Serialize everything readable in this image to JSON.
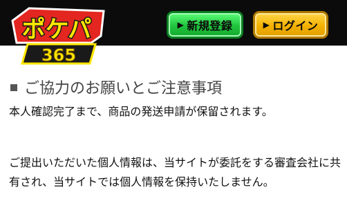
{
  "header": {
    "logo_text_main": "ポケパ",
    "logo_text_sub": "365",
    "register_button": "新規登録",
    "login_button": "ログイン"
  },
  "main": {
    "section_title": "ご協力のお願いとご注意事項",
    "paragraph1": "本人確認完了まで、商品の発送申請が保留されます。",
    "paragraph2": "ご提出いただいた個人情報は、当サイトが委託をする審査会社に共有され、当サイトでは個人情報を保持いたしません。"
  },
  "colors": {
    "header_bg": "#0b0b0b",
    "register_green": "#1fc33c",
    "login_yellow": "#f4b000",
    "logo_red": "#e3261f"
  }
}
